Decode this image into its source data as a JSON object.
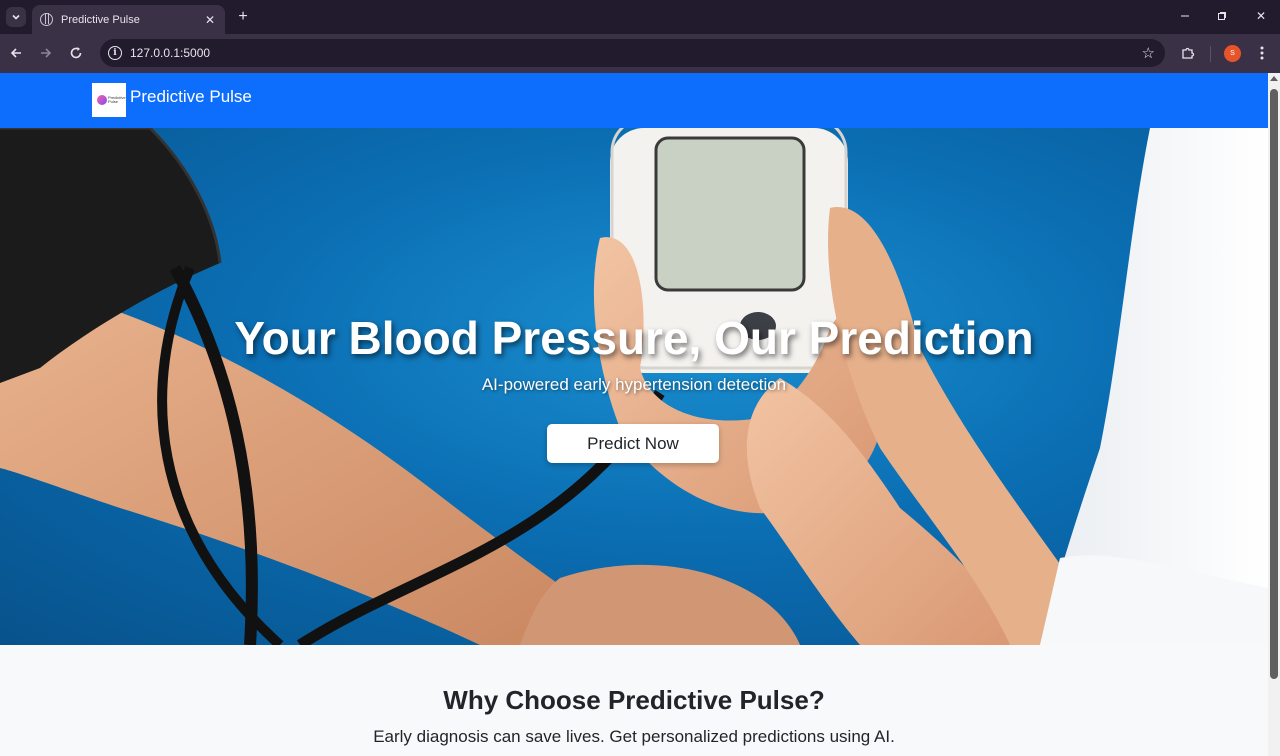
{
  "browser": {
    "tab_title": "Predictive Pulse",
    "url": "127.0.0.1:5000",
    "profile_initial": "S"
  },
  "navbar": {
    "brand": "Predictive Pulse",
    "logo_text": "Predictive Pulse",
    "color": "#0d6efd"
  },
  "hero": {
    "title": "Your Blood Pressure, Our Prediction",
    "subtitle": "AI-powered early hypertension detection",
    "button_label": "Predict Now",
    "image_subject": "blood-pressure-monitor-image"
  },
  "why": {
    "title": "Why Choose Predictive Pulse?",
    "text": "Early diagnosis can save lives. Get personalized predictions using AI."
  },
  "icons": {
    "tab_search": "chevron-down-icon",
    "favicon": "globe-icon",
    "tab_close": "close-icon",
    "new_tab": "plus-icon",
    "back": "arrow-left-icon",
    "forward": "arrow-right-icon",
    "reload": "reload-icon",
    "site_info": "info-icon",
    "bookmark": "star-icon",
    "extensions": "puzzle-icon",
    "menu": "kebab-menu-icon"
  }
}
